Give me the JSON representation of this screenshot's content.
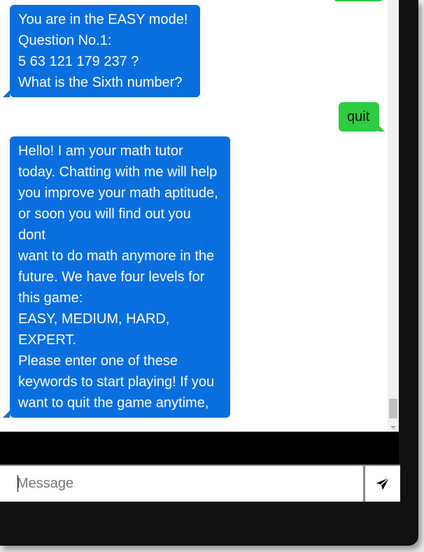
{
  "messages": [
    {
      "sender": "bot",
      "text": "You are in the EASY mode!\nQuestion No.1:\n5 63 121 179 237 ?\nWhat is the Sixth number?"
    },
    {
      "sender": "user",
      "text": "quit"
    },
    {
      "sender": "bot",
      "text": "Hello! I am your math tutor\ntoday. Chatting with me will help\nyou improve your math aptitude,\nor soon you will find out you dont\nwant to do math anymore in the\nfuture. We have four levels for\nthis game:\nEASY, MEDIUM, HARD,\nEXPERT.\nPlease enter one of these\nkeywords to start playing! If you\nwant to quit the game anytime,\nyou can type \"EXIT\" or \"QUIT \"."
    }
  ],
  "composer": {
    "placeholder": "Message",
    "send_icon": "paper-plane-icon"
  },
  "colors": {
    "bot_bubble": "#0a6fde",
    "user_bubble": "#2ecc40",
    "background": "#ffffff"
  }
}
